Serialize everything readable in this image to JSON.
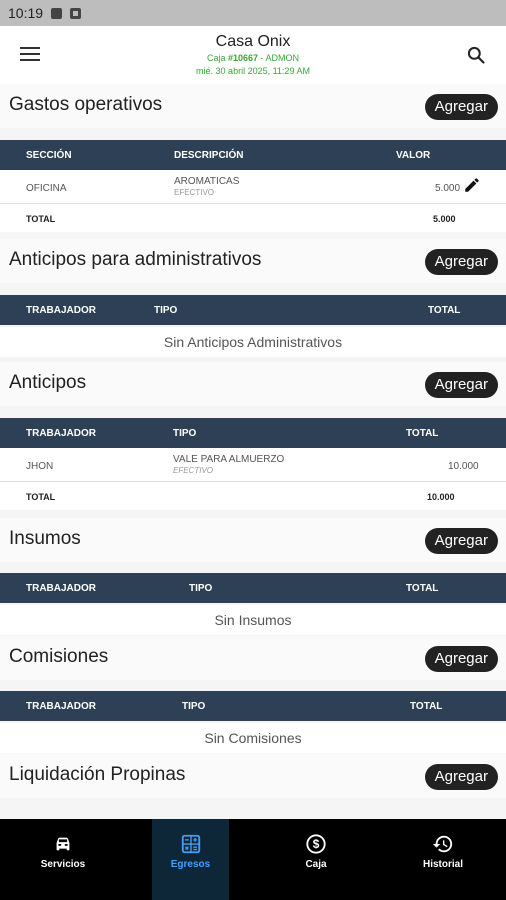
{
  "status": {
    "time": "10:19"
  },
  "header": {
    "title": "Casa Onix",
    "sub_prefix": "Caja ",
    "sub_number": "#10667",
    "sub_suffix": " - ADMON",
    "date": "mié. 30 abril 2025, 11:29 AM"
  },
  "add_label": "Agregar",
  "gastos": {
    "title": "Gastos operativos",
    "headers": [
      "SECCIÓN",
      "DESCRIPCIÓN",
      "VALOR"
    ],
    "rows": [
      {
        "seccion": "OFICINA",
        "descripcion": "AROMATICAS",
        "metodo": "EFECTIVO",
        "valor": "5.000"
      }
    ],
    "total_label": "TOTAL",
    "total_value": "5.000"
  },
  "anticipos_admin": {
    "title": "Anticipos para administrativos",
    "headers": [
      "TRABAJADOR",
      "TIPO",
      "TOTAL"
    ],
    "empty": "Sin Anticipos Administrativos"
  },
  "anticipos": {
    "title": "Anticipos",
    "headers": [
      "TRABAJADOR",
      "TIPO",
      "TOTAL"
    ],
    "rows": [
      {
        "trabajador": "JHON",
        "tipo": "VALE PARA ALMUERZO",
        "metodo": "EFECTIVO",
        "total": "10.000"
      }
    ],
    "total_label": "TOTAL",
    "total_value": "10.000"
  },
  "insumos": {
    "title": "Insumos",
    "headers": [
      "TRABAJADOR",
      "TIPO",
      "TOTAL"
    ],
    "empty": "Sin Insumos"
  },
  "comisiones": {
    "title": "Comisiones",
    "headers": [
      "TRABAJADOR",
      "TIPO",
      "TOTAL"
    ],
    "empty": "Sin Comisiones"
  },
  "propinas": {
    "title": "Liquidación Propinas"
  },
  "nav": {
    "items": [
      {
        "label": "Servicios",
        "icon": "car-icon"
      },
      {
        "label": "Egresos",
        "icon": "calculator-icon"
      },
      {
        "label": "Caja",
        "icon": "dollar-icon"
      },
      {
        "label": "Historial",
        "icon": "history-icon"
      }
    ],
    "active": "Egresos"
  },
  "colors": {
    "header_bg": "#2e4055",
    "accent_green": "#3aa63a",
    "active_nav": "#3fa0ff"
  }
}
